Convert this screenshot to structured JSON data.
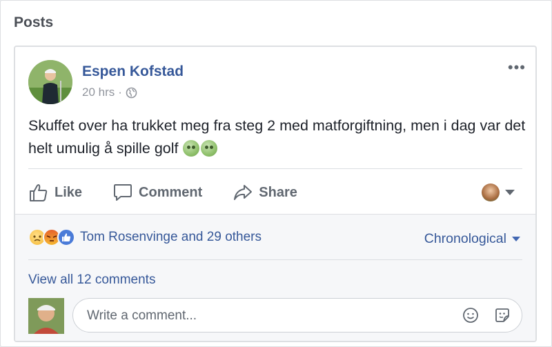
{
  "section": {
    "title": "Posts"
  },
  "post": {
    "author": "Espen Kofstad",
    "time": "20 hrs",
    "separator": "·",
    "privacy_icon": "globe-icon",
    "text": "Skuffet over ha trukket meg fra steg 2 med matforgiftning, men i dag var det helt umulig å spille golf",
    "emojis": [
      "sick-face-emoji",
      "sick-face-emoji"
    ],
    "more_label": "•••"
  },
  "actions": {
    "like": "Like",
    "comment": "Comment",
    "share": "Share"
  },
  "feedback": {
    "reactions": [
      "sad",
      "angry",
      "like"
    ],
    "reactors": "Tom Rosenvinge and 29 others",
    "order": "Chronological",
    "view_all": "View all 12 comments"
  },
  "composer": {
    "placeholder": "Write a comment..."
  },
  "colors": {
    "link": "#365899",
    "muted": "#606770",
    "background": "#f6f7f9"
  }
}
